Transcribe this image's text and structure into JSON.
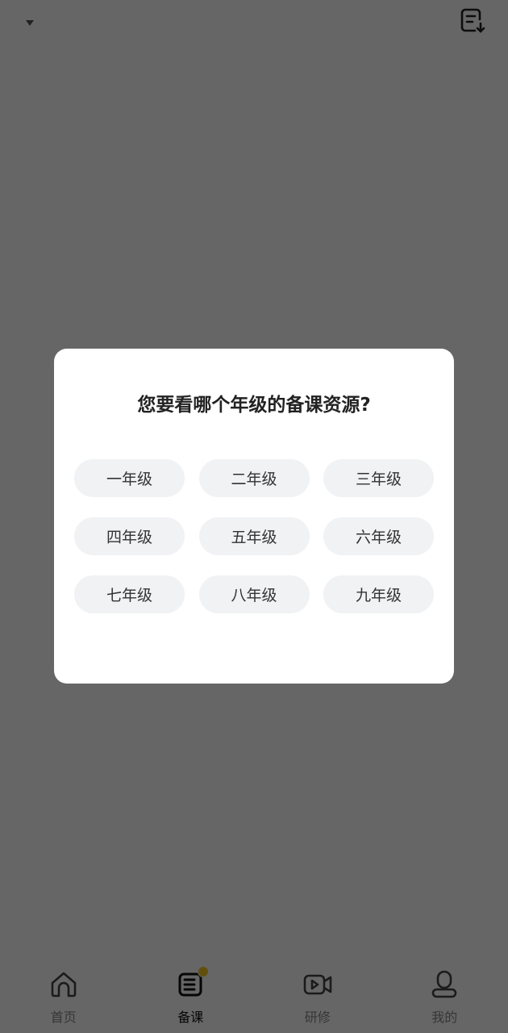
{
  "dialog": {
    "title": "您要看哪个年级的备课资源?",
    "grades": [
      "一年级",
      "二年级",
      "三年级",
      "四年级",
      "五年级",
      "六年级",
      "七年级",
      "八年级",
      "九年级"
    ]
  },
  "bottom_nav": {
    "items": [
      {
        "label": "首页",
        "icon": "home-icon"
      },
      {
        "label": "备课",
        "icon": "lesson-prep-icon",
        "active": true
      },
      {
        "label": "研修",
        "icon": "video-icon"
      },
      {
        "label": "我的",
        "icon": "profile-icon"
      }
    ]
  },
  "top_bar": {
    "icons": [
      "chevron-down-icon",
      "download-list-icon"
    ]
  },
  "colors": {
    "overlay": "#000000",
    "accent_dot": "#f5c623",
    "grade_button_bg": "#f1f2f4"
  }
}
